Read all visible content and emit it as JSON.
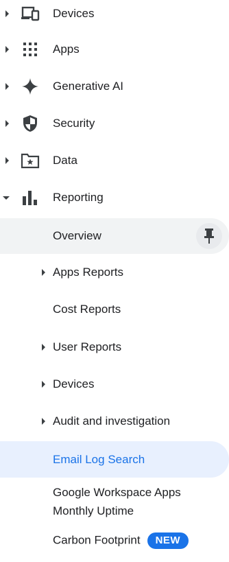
{
  "top_items": [
    {
      "label": "Devices",
      "icon": "devices-icon"
    },
    {
      "label": "Apps",
      "icon": "apps-grid-icon"
    },
    {
      "label": "Generative AI",
      "icon": "sparkle-icon"
    },
    {
      "label": "Security",
      "icon": "shield-icon"
    },
    {
      "label": "Data",
      "icon": "folder-star-icon"
    },
    {
      "label": "Reporting",
      "icon": "bar-chart-icon"
    }
  ],
  "reporting_children": [
    {
      "label": "Overview"
    },
    {
      "label": "Apps Reports"
    },
    {
      "label": "Cost Reports"
    },
    {
      "label": "User Reports"
    },
    {
      "label": "Devices"
    },
    {
      "label": "Audit and investigation"
    },
    {
      "label": "Email Log Search"
    },
    {
      "label": "Google Workspace Apps Monthly Uptime"
    },
    {
      "label": "Carbon Footprint",
      "badge": "NEW"
    }
  ],
  "colors": {
    "text": "#202124",
    "active_text": "#1a73e8",
    "active_bg": "#e8f0fe",
    "hover_bg": "#f1f3f4",
    "badge_bg": "#1a73e8"
  }
}
